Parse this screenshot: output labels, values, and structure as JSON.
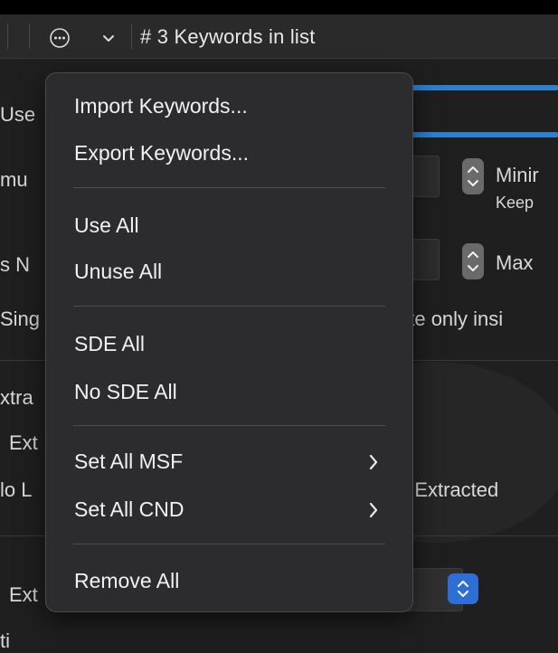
{
  "toolbar": {
    "more_icon": "ellipsis-circle-icon",
    "dropdown_icon": "chevron-down-icon",
    "keywords_label": "# 3 Keywords in list"
  },
  "background": {
    "use_text": "Use",
    "mu_text": "mu",
    "min_label": "Minir",
    "keep_label": "Keep",
    "sn_text": "s N",
    "max_label": "Max",
    "sing_text": "Sing",
    "inside_text": "ate only insi",
    "extra_text": "xtra",
    "ext_text": "Ext",
    "lo_text": "lo L",
    "extracted_text": "rl Extracted",
    "ext2_text": "Ext",
    "partial_bottom": "ti"
  },
  "menu": {
    "items": {
      "import": "Import Keywords...",
      "export": "Export Keywords...",
      "use_all": "Use All",
      "unuse_all": "Unuse All",
      "sde_all": "SDE All",
      "no_sde_all": "No SDE All",
      "set_all_msf": "Set All MSF",
      "set_all_cnd": "Set All CND",
      "remove_all": "Remove All"
    },
    "submenu_icon": "chevron-right-icon"
  },
  "colors": {
    "accent_blue": "#2f7fd1",
    "menu_bg": "#2c2c2e",
    "window_bg": "#1f1f1f"
  }
}
